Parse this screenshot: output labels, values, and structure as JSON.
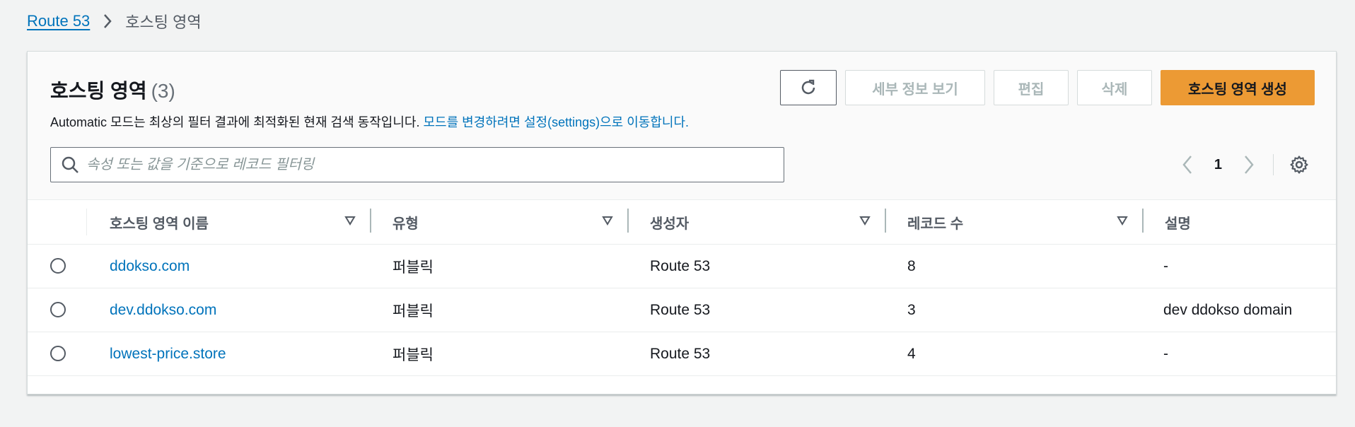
{
  "breadcrumb": {
    "root": "Route 53",
    "current": "호스팅 영역"
  },
  "header": {
    "title": "호스팅 영역",
    "count": "(3)",
    "description_prefix": "Automatic 모드는 최상의 필터 결과에 최적화된 현재 검색 동작입니다. ",
    "description_link": "모드를 변경하려면 설정(settings)으로 이동합니다."
  },
  "toolbar": {
    "refresh_icon": "refresh-icon",
    "view_details_label": "세부 정보 보기",
    "edit_label": "편집",
    "delete_label": "삭제",
    "create_label": "호스팅 영역 생성"
  },
  "search": {
    "placeholder": "속성 또는 값을 기준으로 레코드 필터링",
    "value": ""
  },
  "pagination": {
    "current_page": "1"
  },
  "table": {
    "columns": [
      "호스팅 영역 이름",
      "유형",
      "생성자",
      "레코드 수",
      "설명"
    ],
    "rows": [
      {
        "name": "ddokso.com",
        "type": "퍼블릭",
        "created_by": "Route 53",
        "record_count": "8",
        "description": "-"
      },
      {
        "name": "dev.ddokso.com",
        "type": "퍼블릭",
        "created_by": "Route 53",
        "record_count": "3",
        "description": "dev ddokso domain"
      },
      {
        "name": "lowest-price.store",
        "type": "퍼블릭",
        "created_by": "Route 53",
        "record_count": "4",
        "description": "-"
      }
    ]
  },
  "colors": {
    "link": "#0073bb",
    "primary_button": "#ec9a34",
    "disabled_text": "#aab7b8"
  }
}
